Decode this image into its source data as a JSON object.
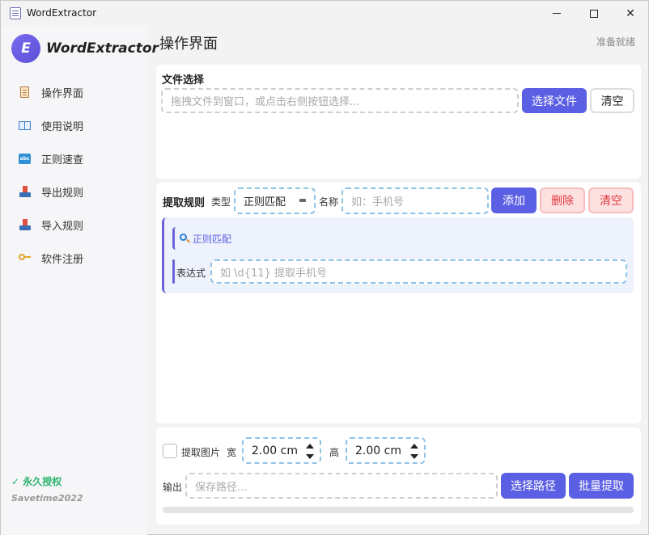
{
  "window": {
    "title": "WordExtractor"
  },
  "sidebar": {
    "brand_letter": "E",
    "brand_name": "WordExtractor",
    "items": [
      {
        "label": "操作界面",
        "icon": "clipboard-icon"
      },
      {
        "label": "使用说明",
        "icon": "book-icon"
      },
      {
        "label": "正则速查",
        "icon": "abc-icon"
      },
      {
        "label": "导出规则",
        "icon": "tray-icon"
      },
      {
        "label": "导入规则",
        "icon": "tray-icon"
      },
      {
        "label": "软件注册",
        "icon": "key-icon"
      }
    ],
    "license": "✓ 永久授权",
    "user": "Savetime2022"
  },
  "header": {
    "title": "操作界面",
    "status": "准备就绪"
  },
  "file_section": {
    "label": "文件选择",
    "drop_placeholder": "拖拽文件到窗口，或点击右侧按钮选择...",
    "select_button": "选择文件",
    "clear_button": "清空"
  },
  "rules_section": {
    "label": "提取规则",
    "type_label": "类型",
    "type_value": "正则匹配",
    "name_label": "名称",
    "name_placeholder": "如：手机号",
    "add_button": "添加",
    "delete_button": "删除",
    "clear_button": "清空",
    "rule": {
      "type_text": "正则匹配",
      "expr_label": "表达式",
      "expr_placeholder": "如 \\d{11} 提取手机号"
    }
  },
  "output_section": {
    "extract_images_label": "提取图片",
    "width_label": "宽",
    "width_value": "2.00 cm",
    "height_label": "高",
    "height_value": "2.00 cm",
    "output_label": "输出",
    "path_placeholder": "保存路径...",
    "path_button": "选择路径",
    "batch_button": "批量提取",
    "progress": 0
  },
  "colors": {
    "accent": "#5b5fe3",
    "danger": "#e0393e",
    "success": "#2bb36b",
    "dash_border": "#8fc3e6"
  }
}
